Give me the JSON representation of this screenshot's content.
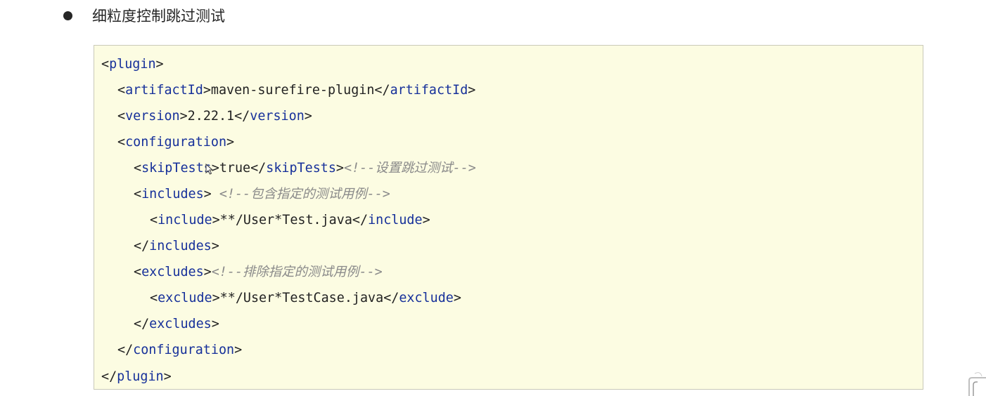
{
  "heading": {
    "text": "细粒度控制跳过测试"
  },
  "code": {
    "lines": [
      {
        "parts": [
          {
            "t": "<",
            "k": "punc"
          },
          {
            "t": "plugin",
            "k": "tag"
          },
          {
            "t": ">",
            "k": "punc"
          }
        ]
      },
      {
        "parts": [
          {
            "t": "<",
            "k": "punc"
          },
          {
            "t": "artifactId",
            "k": "tag"
          },
          {
            "t": ">",
            "k": "punc"
          },
          {
            "t": "maven-surefire-plugin",
            "k": "text"
          },
          {
            "t": "</",
            "k": "punc"
          },
          {
            "t": "artifactId",
            "k": "tag"
          },
          {
            "t": ">",
            "k": "punc"
          }
        ]
      },
      {
        "parts": [
          {
            "t": "<",
            "k": "punc"
          },
          {
            "t": "version",
            "k": "tag"
          },
          {
            "t": ">",
            "k": "punc"
          },
          {
            "t": "2.22.1",
            "k": "text"
          },
          {
            "t": "</",
            "k": "punc"
          },
          {
            "t": "version",
            "k": "tag"
          },
          {
            "t": ">",
            "k": "punc"
          }
        ]
      },
      {
        "parts": [
          {
            "t": "<",
            "k": "punc"
          },
          {
            "t": "configuration",
            "k": "tag"
          },
          {
            "t": ">",
            "k": "punc"
          }
        ]
      },
      {
        "parts": [
          {
            "t": "<",
            "k": "punc"
          },
          {
            "t": "skipTests",
            "k": "tag"
          },
          {
            "t": ">",
            "k": "punc"
          },
          {
            "t": "true",
            "k": "text"
          },
          {
            "t": "</",
            "k": "punc"
          },
          {
            "t": "skipTests",
            "k": "tag"
          },
          {
            "t": ">",
            "k": "punc"
          },
          {
            "t": "<!--设置跳过测试-->",
            "k": "comment"
          }
        ]
      },
      {
        "parts": [
          {
            "t": "<",
            "k": "punc"
          },
          {
            "t": "includes",
            "k": "tag"
          },
          {
            "t": "> ",
            "k": "punc"
          },
          {
            "t": "<!--包含指定的测试用例-->",
            "k": "comment"
          }
        ]
      },
      {
        "parts": [
          {
            "t": "<",
            "k": "punc"
          },
          {
            "t": "include",
            "k": "tag"
          },
          {
            "t": ">",
            "k": "punc"
          },
          {
            "t": "**/User*Test.java",
            "k": "text"
          },
          {
            "t": "</",
            "k": "punc"
          },
          {
            "t": "include",
            "k": "tag"
          },
          {
            "t": ">",
            "k": "punc"
          }
        ]
      },
      {
        "parts": [
          {
            "t": "</",
            "k": "punc"
          },
          {
            "t": "includes",
            "k": "tag"
          },
          {
            "t": ">",
            "k": "punc"
          }
        ]
      },
      {
        "parts": [
          {
            "t": "<",
            "k": "punc"
          },
          {
            "t": "excludes",
            "k": "tag"
          },
          {
            "t": ">",
            "k": "punc"
          },
          {
            "t": "<!--排除指定的测试用例-->",
            "k": "comment"
          }
        ]
      },
      {
        "parts": [
          {
            "t": "<",
            "k": "punc"
          },
          {
            "t": "exclude",
            "k": "tag"
          },
          {
            "t": ">",
            "k": "punc"
          },
          {
            "t": "**/User*TestCase.java",
            "k": "text"
          },
          {
            "t": "</",
            "k": "punc"
          },
          {
            "t": "exclude",
            "k": "tag"
          },
          {
            "t": ">",
            "k": "punc"
          }
        ]
      },
      {
        "parts": [
          {
            "t": "</",
            "k": "punc"
          },
          {
            "t": "excludes",
            "k": "tag"
          },
          {
            "t": ">",
            "k": "punc"
          }
        ]
      },
      {
        "parts": [
          {
            "t": "</",
            "k": "punc"
          },
          {
            "t": "configuration",
            "k": "tag"
          },
          {
            "t": ">",
            "k": "punc"
          }
        ]
      },
      {
        "parts": [
          {
            "t": "</",
            "k": "punc"
          },
          {
            "t": "plugin",
            "k": "tag"
          },
          {
            "t": ">",
            "k": "punc"
          }
        ]
      }
    ]
  },
  "colors": {
    "tag": "#16309a",
    "comment": "#8a8a8a",
    "code_background": "#fcfce2"
  },
  "icons": {
    "cursor": "mouse-pointer-icon",
    "corner": "page-corner-icon"
  }
}
